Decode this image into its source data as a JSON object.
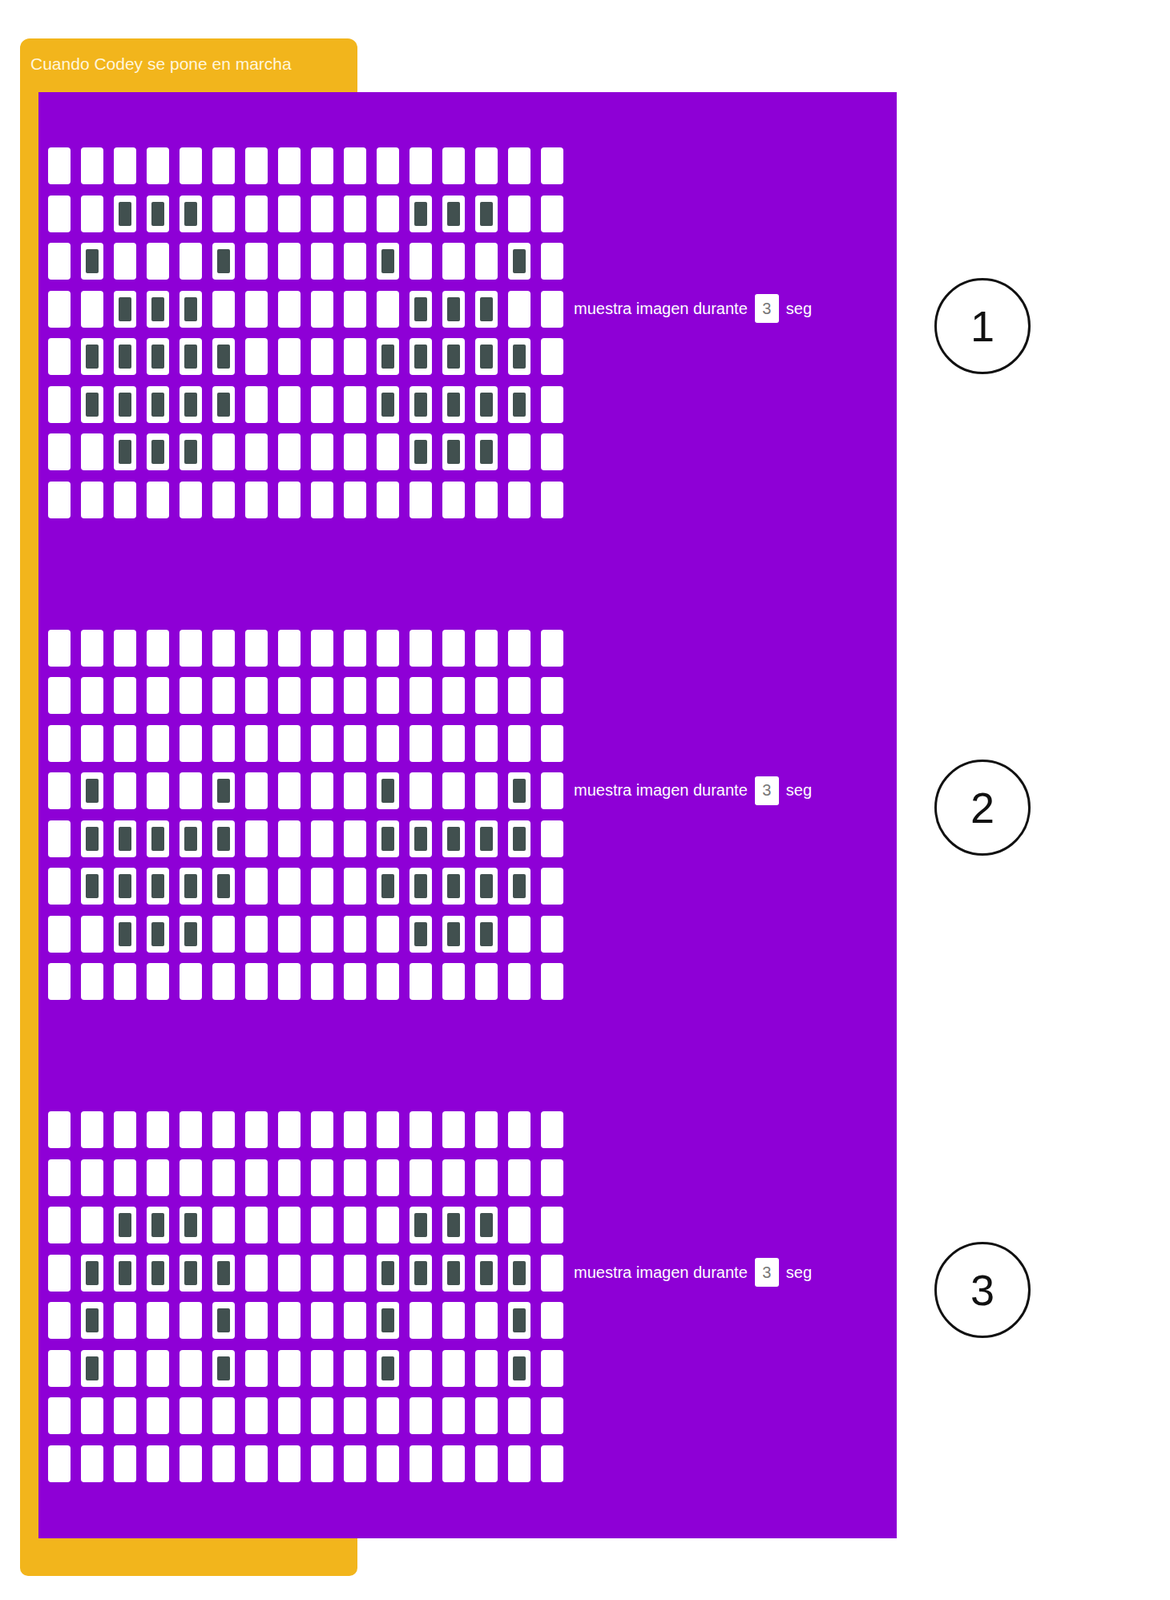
{
  "trigger": {
    "label": "Cuando Codey se pone en marcha"
  },
  "blocks": [
    {
      "label": "muestra imagen durante",
      "seconds": "3",
      "unit": "seg",
      "marker": "1",
      "leds": [
        [
          false,
          false,
          false,
          false,
          false,
          false,
          false,
          false,
          false,
          false,
          false,
          false,
          false,
          false,
          false,
          false
        ],
        [
          false,
          false,
          true,
          true,
          true,
          false,
          false,
          false,
          false,
          false,
          false,
          true,
          true,
          true,
          false,
          false
        ],
        [
          false,
          true,
          false,
          false,
          false,
          true,
          false,
          false,
          false,
          false,
          true,
          false,
          false,
          false,
          true,
          false
        ],
        [
          false,
          false,
          true,
          true,
          true,
          false,
          false,
          false,
          false,
          false,
          false,
          true,
          true,
          true,
          false,
          false
        ],
        [
          false,
          true,
          true,
          true,
          true,
          true,
          false,
          false,
          false,
          false,
          true,
          true,
          true,
          true,
          true,
          false
        ],
        [
          false,
          true,
          true,
          true,
          true,
          true,
          false,
          false,
          false,
          false,
          true,
          true,
          true,
          true,
          true,
          false
        ],
        [
          false,
          false,
          true,
          true,
          true,
          false,
          false,
          false,
          false,
          false,
          false,
          true,
          true,
          true,
          false,
          false
        ],
        [
          false,
          false,
          false,
          false,
          false,
          false,
          false,
          false,
          false,
          false,
          false,
          false,
          false,
          false,
          false,
          false
        ]
      ]
    },
    {
      "label": "muestra imagen durante",
      "seconds": "3",
      "unit": "seg",
      "marker": "2",
      "leds": [
        [
          false,
          false,
          false,
          false,
          false,
          false,
          false,
          false,
          false,
          false,
          false,
          false,
          false,
          false,
          false,
          false
        ],
        [
          false,
          false,
          false,
          false,
          false,
          false,
          false,
          false,
          false,
          false,
          false,
          false,
          false,
          false,
          false,
          false
        ],
        [
          false,
          false,
          false,
          false,
          false,
          false,
          false,
          false,
          false,
          false,
          false,
          false,
          false,
          false,
          false,
          false
        ],
        [
          false,
          true,
          false,
          false,
          false,
          true,
          false,
          false,
          false,
          false,
          true,
          false,
          false,
          false,
          true,
          false
        ],
        [
          false,
          true,
          true,
          true,
          true,
          true,
          false,
          false,
          false,
          false,
          true,
          true,
          true,
          true,
          true,
          false
        ],
        [
          false,
          true,
          true,
          true,
          true,
          true,
          false,
          false,
          false,
          false,
          true,
          true,
          true,
          true,
          true,
          false
        ],
        [
          false,
          false,
          true,
          true,
          true,
          false,
          false,
          false,
          false,
          false,
          false,
          true,
          true,
          true,
          false,
          false
        ],
        [
          false,
          false,
          false,
          false,
          false,
          false,
          false,
          false,
          false,
          false,
          false,
          false,
          false,
          false,
          false,
          false
        ]
      ]
    },
    {
      "label": "muestra imagen durante",
      "seconds": "3",
      "unit": "seg",
      "marker": "3",
      "leds": [
        [
          false,
          false,
          false,
          false,
          false,
          false,
          false,
          false,
          false,
          false,
          false,
          false,
          false,
          false,
          false,
          false
        ],
        [
          false,
          false,
          false,
          false,
          false,
          false,
          false,
          false,
          false,
          false,
          false,
          false,
          false,
          false,
          false,
          false
        ],
        [
          false,
          false,
          true,
          true,
          true,
          false,
          false,
          false,
          false,
          false,
          false,
          true,
          true,
          true,
          false,
          false
        ],
        [
          false,
          true,
          true,
          true,
          true,
          true,
          false,
          false,
          false,
          false,
          true,
          true,
          true,
          true,
          true,
          false
        ],
        [
          false,
          true,
          false,
          false,
          false,
          true,
          false,
          false,
          false,
          false,
          true,
          false,
          false,
          false,
          true,
          false
        ],
        [
          false,
          true,
          false,
          false,
          false,
          true,
          false,
          false,
          false,
          false,
          true,
          false,
          false,
          false,
          true,
          false
        ],
        [
          false,
          false,
          false,
          false,
          false,
          false,
          false,
          false,
          false,
          false,
          false,
          false,
          false,
          false,
          false,
          false
        ],
        [
          false,
          false,
          false,
          false,
          false,
          false,
          false,
          false,
          false,
          false,
          false,
          false,
          false,
          false,
          false,
          false
        ]
      ]
    }
  ]
}
